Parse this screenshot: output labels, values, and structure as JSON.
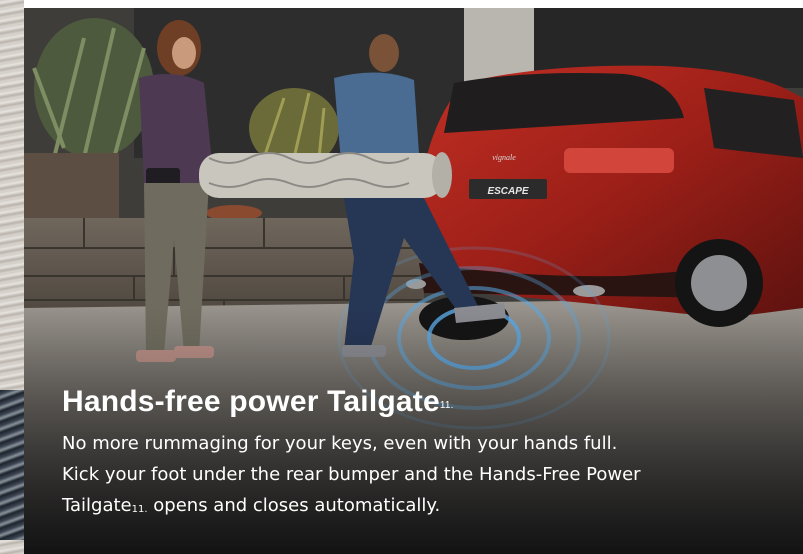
{
  "headline": {
    "text": "Hands-free power Tailgate",
    "footnote_marker": "11."
  },
  "body": {
    "line1": "No more rummaging for your keys, even with your hands full.",
    "line2": "Kick your foot under the rear bumper and the Hands-Free Power",
    "line3_before": "Tailgate",
    "line3_marker": "11.",
    "line3_after": " opens and closes automatically."
  },
  "vehicle": {
    "badge_text": "ESCAPE",
    "model_script": "vignale"
  },
  "colors": {
    "car_red": "#a3201a",
    "text": "#ffffff",
    "sensor_glow": "#5aa9e6"
  }
}
